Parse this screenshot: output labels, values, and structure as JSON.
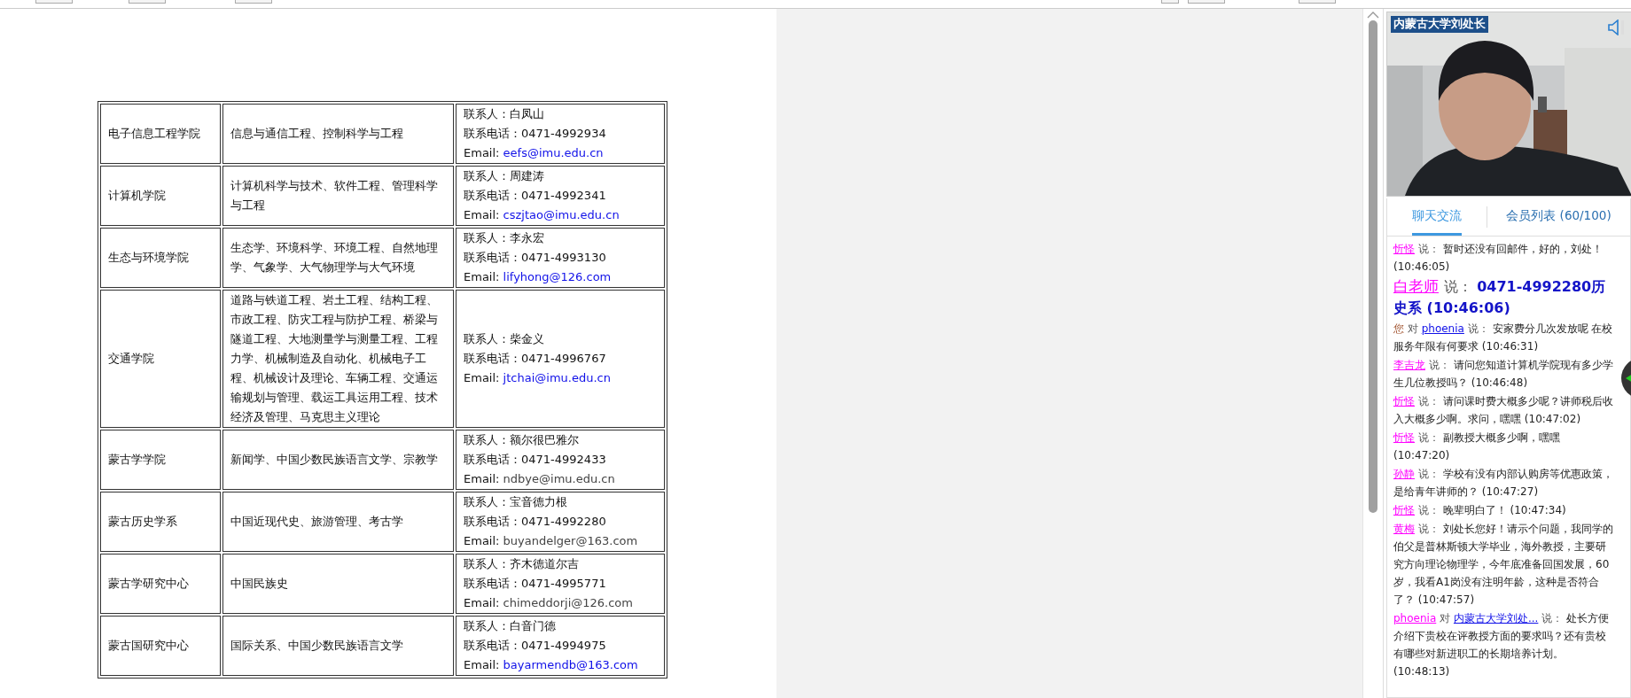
{
  "table": {
    "rows": [
      {
        "college": "电子信息工程学院",
        "majors": "信息与通信工程、控制科学与工程",
        "contact": "联系人：白凤山",
        "phone": "联系电话：0471-4992934",
        "email_prefix": "Email:",
        "email": "eefs@imu.edu.cn",
        "email_link": true
      },
      {
        "college": "计算机学院",
        "majors": "计算机科学与技术、软件工程、管理科学与工程",
        "contact": "联系人：周建涛",
        "phone": "联系电话：0471-4992341",
        "email_prefix": "Email:",
        "email": "cszjtao@imu.edu.cn",
        "email_link": true
      },
      {
        "college": "生态与环境学院",
        "majors": "生态学、环境科学、环境工程、自然地理学、气象学、大气物理学与大气环境",
        "contact": "联系人：李永宏",
        "phone": "联系电话：0471-4993130",
        "email_prefix": "Email:",
        "email": "lifyhong@126.com",
        "email_link": true
      },
      {
        "college": "交通学院",
        "majors": "道路与铁道工程、岩土工程、结构工程、市政工程、防灾工程与防护工程、桥梁与隧道工程、大地测量学与测量工程、工程力学、机械制造及自动化、机械电子工程、机械设计及理论、车辆工程、交通运输规划与管理、载运工具运用工程、技术经济及管理、马克思主义理论",
        "contact": "联系人：柴金义",
        "phone": "联系电话：0471-4996767",
        "email_prefix": "Email:",
        "email": "jtchai@imu.edu.cn",
        "email_link": true
      },
      {
        "college": "蒙古学学院",
        "majors": "新闻学、中国少数民族语言文学、宗教学",
        "contact": "联系人：额尔很巴雅尔",
        "phone": "联系电话：0471-4992433",
        "email_prefix": "Email:",
        "email": "ndbye@imu.edu.cn",
        "email_link": false
      },
      {
        "college": "蒙古历史学系",
        "majors": "中国近现代史、旅游管理、考古学",
        "contact": "联系人：宝音德力根",
        "phone": "联系电话：0471-4992280",
        "email_prefix": "Email:",
        "email": "buyandelger@163.com",
        "email_link": false
      },
      {
        "college": "蒙古学研究中心",
        "majors": "中国民族史",
        "contact": "联系人：齐木德道尔吉",
        "phone": "联系电话：0471-4995771",
        "email_prefix": "Email:",
        "email": "chimeddorji@126.com",
        "email_link": false
      },
      {
        "college": "蒙古国研究中心",
        "majors": "国际关系、中国少数民族语言文学",
        "contact": "联系人：白音门德",
        "phone": "联系电话：0471-4994975",
        "email_prefix": "Email:",
        "email": "bayarmendb@163.com",
        "email_link": true
      }
    ]
  },
  "live": {
    "video_title": "内蒙古大学刘处长",
    "tabs": [
      {
        "label": "聊天交流",
        "selected": true
      },
      {
        "label": "会员列表 (60/100)",
        "selected": false
      }
    ],
    "messages": [
      {
        "kind": "normal",
        "sender": "忻怪",
        "sender_self": false,
        "says": "说：",
        "text": "暂时还没有回邮件，好的，刘处！",
        "time": "(10:46:05)"
      },
      {
        "kind": "large",
        "sender": "白老师",
        "sender_self": false,
        "says": "说：",
        "text": "0471-4992280历史系 (10:46:06)"
      },
      {
        "kind": "normal",
        "sender": "您",
        "sender_self": true,
        "to_word": "对",
        "to": "phoenia",
        "says": "说：",
        "text": "安家费分几次发放呢 在校服务年限有何要求",
        "time": "(10:46:31)"
      },
      {
        "kind": "normal",
        "sender": "李吉龙",
        "sender_self": false,
        "says": "说：",
        "text": "请问您知道计算机学院现有多少学生几位教授吗？",
        "time": "(10:46:48)"
      },
      {
        "kind": "normal",
        "sender": "忻怪",
        "sender_self": false,
        "says": "说：",
        "text": "请问课时费大概多少呢？讲师税后收入大概多少啊。求问，嘿嘿",
        "time": "(10:47:02)"
      },
      {
        "kind": "normal",
        "sender": "忻怪",
        "sender_self": false,
        "says": "说：",
        "text": "副教授大概多少啊，嘿嘿",
        "time": "(10:47:20)"
      },
      {
        "kind": "normal",
        "sender": "孙静",
        "sender_self": false,
        "says": "说：",
        "text": "学校有没有内部认购房等优惠政策，是给青年讲师的？",
        "time": "(10:47:27)"
      },
      {
        "kind": "normal",
        "sender": "忻怪",
        "sender_self": false,
        "says": "说：",
        "text": "晚辈明白了！",
        "time": "(10:47:34)"
      },
      {
        "kind": "normal",
        "sender": "黄梅",
        "sender_self": false,
        "says": "说：",
        "text": "刘处长您好！请示个问题，我同学的伯父是普林斯顿大学毕业，海外教授，主要研究方向理论物理学，今年底准备回国发展，60岁，我看A1岗没有注明年龄，这种是否符合了？",
        "time": "(10:47:57)"
      },
      {
        "kind": "normal",
        "sender": "phoenia",
        "sender_self": false,
        "to_word": "对",
        "to": "内蒙古大学刘处...",
        "says": "说：",
        "text": "处长方便介绍下贵校在评教授方面的要求吗？还有贵校有哪些对新进职工的长期培养计划。",
        "time": "(10:48:13)"
      }
    ]
  }
}
